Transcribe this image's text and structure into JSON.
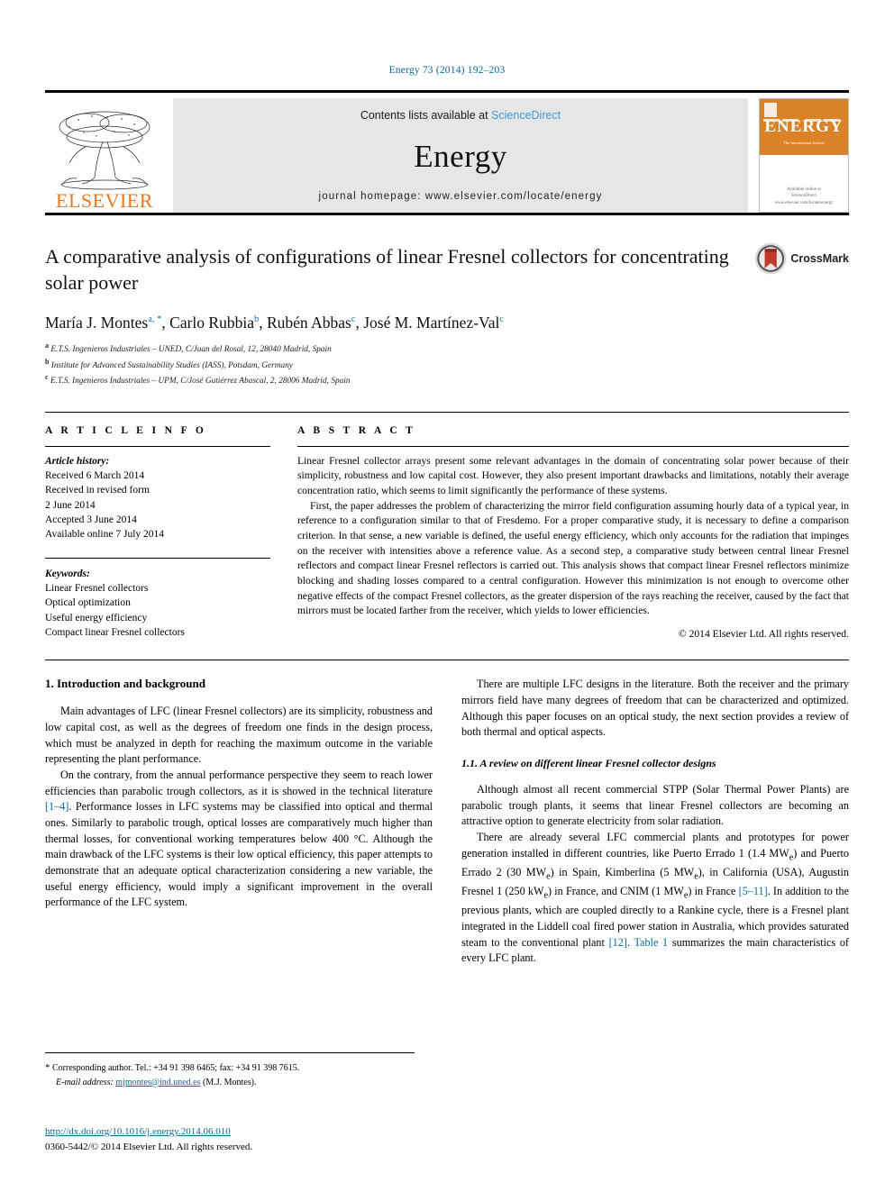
{
  "running_head": "Energy 73 (2014) 192–203",
  "masthead": {
    "publisher": "ELSEVIER",
    "contents_prefix": "Contents lists available at",
    "contents_link": "ScienceDirect",
    "journal_name": "Energy",
    "homepage": "journal homepage: www.elsevier.com/locate/energy",
    "cover": {
      "title": "ENERGY",
      "subtitle": "The International Journal",
      "footer_line1": "Available online at",
      "footer_line2": "ScienceDirect",
      "footer_line3": "www.elsevier.com/locate/energy"
    },
    "accent_orange": "#E87722",
    "link_blue": "#3a9bd9"
  },
  "article": {
    "title": "A comparative analysis of configurations of linear Fresnel collectors for concentrating solar power",
    "crossmark_label": "CrossMark",
    "authors": [
      {
        "name": "María J. Montes",
        "marks": "a, *"
      },
      {
        "name": "Carlo Rubbia",
        "marks": "b"
      },
      {
        "name": "Rubén Abbas",
        "marks": "c"
      },
      {
        "name": "José M. Martínez-Val",
        "marks": "c"
      }
    ],
    "affiliations": [
      {
        "label": "a",
        "text": "E.T.S. Ingenieros Industriales – UNED, C/Juan del Rosal, 12, 28040 Madrid, Spain"
      },
      {
        "label": "b",
        "text": "Institute for Advanced Sustainability Studies (IASS), Potsdam, Germany"
      },
      {
        "label": "c",
        "text": "E.T.S. Ingenieros Industriales – UPM, C/José Gutiérrez Abascal, 2, 28006 Madrid, Spain"
      }
    ]
  },
  "article_info": {
    "heading": "A R T I C L E   I N F O",
    "history_heading": "Article history:",
    "history": [
      "Received 6 March 2014",
      "Received in revised form",
      "2 June 2014",
      "Accepted 3 June 2014",
      "Available online 7 July 2014"
    ],
    "keywords_heading": "Keywords:",
    "keywords": [
      "Linear Fresnel collectors",
      "Optical optimization",
      "Useful energy efficiency",
      "Compact linear Fresnel collectors"
    ]
  },
  "abstract": {
    "heading": "A B S T R A C T",
    "paragraphs": [
      "Linear Fresnel collector arrays present some relevant advantages in the domain of concentrating solar power because of their simplicity, robustness and low capital cost. However, they also present important drawbacks and limitations, notably their average concentration ratio, which seems to limit significantly the performance of these systems.",
      "First, the paper addresses the problem of characterizing the mirror field configuration assuming hourly data of a typical year, in reference to a configuration similar to that of Fresdemo. For a proper comparative study, it is necessary to define a comparison criterion. In that sense, a new variable is defined, the useful energy efficiency, which only accounts for the radiation that impinges on the receiver with intensities above a reference value. As a second step, a comparative study between central linear Fresnel reflectors and compact linear Fresnel reflectors is carried out. This analysis shows that compact linear Fresnel reflectors minimize blocking and shading losses compared to a central configuration. However this minimization is not enough to overcome other negative effects of the compact Fresnel collectors, as the greater dispersion of the rays reaching the receiver, caused by the fact that mirrors must be located farther from the receiver, which yields to lower efficiencies."
    ],
    "copyright": "© 2014 Elsevier Ltd. All rights reserved."
  },
  "body": {
    "section1_heading": "1.  Introduction and background",
    "left_paragraphs": [
      "Main advantages of LFC (linear Fresnel collectors) are its simplicity, robustness and low capital cost, as well as the degrees of freedom one finds in the design process, which must be analyzed in depth for reaching the maximum outcome in the variable representing the plant performance."
    ],
    "left_para2_a": "On the contrary, from the annual performance perspective they seem to reach lower efficiencies than parabolic trough collectors, as it is showed in the technical literature ",
    "left_para2_ref": "[1–4]",
    "left_para2_b": ". Performance losses in LFC systems may be classified into optical and thermal ones. Similarly to parabolic trough, optical losses are comparatively much higher than thermal losses, for conventional working temperatures below 400 °C. Although the main drawback of the LFC systems is their low optical efficiency, this paper attempts to demonstrate that an adequate optical characterization considering a new variable, the useful energy efficiency, would imply a significant improvement in the overall performance of the LFC system.",
    "right_para1": "There are multiple LFC designs in the literature. Both the receiver and the primary mirrors field have many degrees of freedom that can be characterized and optimized. Although this paper focuses on an optical study, the next section provides a review of both thermal and optical aspects.",
    "subsection_heading": "1.1.  A review on different linear Fresnel collector designs",
    "right_para2": "Although almost all recent commercial STPP (Solar Thermal Power Plants) are parabolic trough plants, it seems that linear Fresnel collectors are becoming an attractive option to generate electricity from solar radiation.",
    "right_para3_a": "There are already several LFC commercial plants and prototypes for power generation installed in different countries, like Puerto Errado 1 (1.4 MW",
    "right_para3_sub1": "e",
    "right_para3_b": ") and Puerto Errado 2 (30 MW",
    "right_para3_sub2": "e",
    "right_para3_c": ") in Spain, Kimberlina (5 MW",
    "right_para3_sub3": "e",
    "right_para3_d": "), in California (USA), Augustin Fresnel 1 (250 kW",
    "right_para3_sub4": "e",
    "right_para3_e": ") in France, and CNIM (1 MW",
    "right_para3_sub5": "e",
    "right_para3_f": ") in France ",
    "right_para3_ref1": "[5–11]",
    "right_para3_g": ". In addition to the previous plants, which are coupled directly to a Rankine cycle, there is a Fresnel plant integrated in the Liddell coal fired power station in Australia, which provides saturated steam to the conventional plant ",
    "right_para3_ref2": "[12]",
    "right_para3_h": ". ",
    "right_para3_table": "Table 1",
    "right_para3_i": " summarizes the main characteristics of every LFC plant."
  },
  "footnote": {
    "star": "*",
    "corresponding": "Corresponding author. Tel.: +34 91 398 6465; fax: +34 91 398 7615.",
    "email_label": "E-mail address:",
    "email": "mjmontes@ind.uned.es",
    "email_owner": "(M.J. Montes)."
  },
  "footer": {
    "doi": "http://dx.doi.org/10.1016/j.energy.2014.06.010",
    "issn_line": "0360-5442/© 2014 Elsevier Ltd. All rights reserved."
  }
}
